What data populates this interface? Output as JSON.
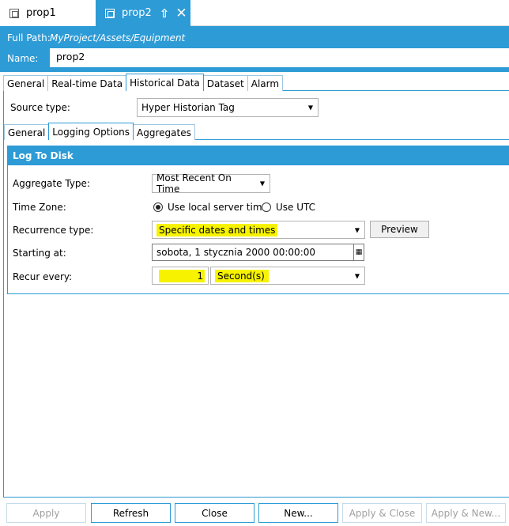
{
  "doc_tabs": [
    {
      "label": "prop1",
      "active": false
    },
    {
      "label": "prop2",
      "active": true
    }
  ],
  "header": {
    "full_path_label": "Full Path:",
    "full_path_value": "MyProject/Assets/Equipment",
    "name_label": "Name:",
    "name_value": "prop2"
  },
  "main_tabs": [
    "General",
    "Real-time Data",
    "Historical Data",
    "Dataset",
    "Alarm"
  ],
  "source_type": {
    "label": "Source type:",
    "value": "Hyper Historian Tag"
  },
  "sub_tabs": [
    "General",
    "Logging Options",
    "Aggregates"
  ],
  "log_to_disk": {
    "title": "Log To Disk",
    "aggregate_type_label": "Aggregate Type:",
    "aggregate_type_value": "Most Recent On Time",
    "time_zone_label": "Time Zone:",
    "tz_local": "Use local server time",
    "tz_utc": "Use UTC",
    "recurrence_label": "Recurrence type:",
    "recurrence_value": "Specific dates and times",
    "preview_label": "Preview",
    "starting_label": "Starting at:",
    "starting_value": "sobota, 1 stycznia 2000 00:00:00",
    "recur_label": "Recur every:",
    "recur_number": "1",
    "recur_unit": "Second(s)"
  },
  "buttons": {
    "apply": "Apply",
    "refresh": "Refresh",
    "close": "Close",
    "new": "New...",
    "apply_close": "Apply & Close",
    "apply_new": "Apply & New..."
  },
  "colors": {
    "accent": "#2d9bd6",
    "highlight": "#f7f300"
  }
}
